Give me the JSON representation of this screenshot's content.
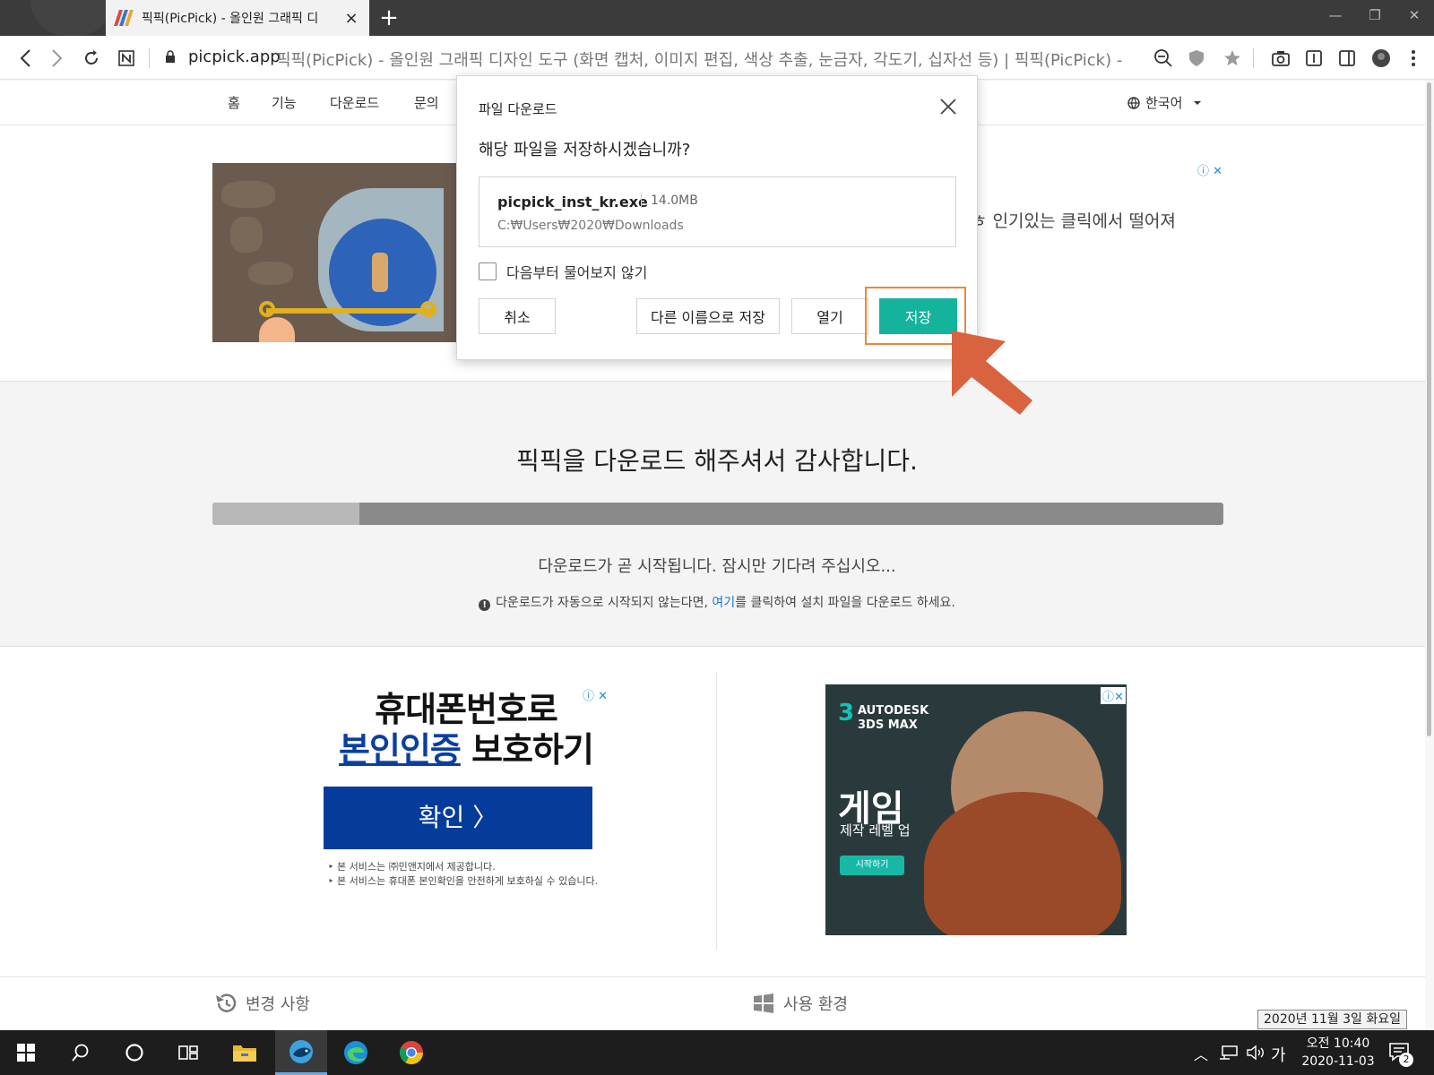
{
  "browser": {
    "tab_title": "픽픽(PicPick) - 올인원 그래픽 디",
    "address_host": "picpick.app",
    "address_title": "픽픽(PicPick) - 올인원 그래픽 디자인 도구 (화면 캡처, 이미지 편집, 색상 추출, 눈금자, 각도기, 십자선 등) | 픽픽(PicPick) -",
    "new_tab_label": "+",
    "tab_close": "×"
  },
  "site_nav": {
    "items": [
      "홈",
      "기능",
      "다운로드",
      "문의"
    ],
    "language": "한국어"
  },
  "top_ad": {
    "snippet": "ㅎ 인기있는 클릭에서 떨어져"
  },
  "download": {
    "thanks": "픽픽을 다운로드 해주셔서 감사합니다.",
    "progress": 0.145,
    "wait_message": "다운로드가 곧 시작됩니다. 잠시만 기다려 주십시오...",
    "note_before": "다운로드가 자동으로 시작되지 않는다면, ",
    "note_link": "여기",
    "note_after": "를 클릭하여 설치 파일을 다운로드 하세요."
  },
  "ad_left": {
    "line1": "휴대폰번호로",
    "line2_em": "본인인증",
    "line2_rest": " 보호하기",
    "button": "확인 〉",
    "fine1": "‣ 본 서비스는 ㈜민앤지에서 제공합니다.",
    "fine2": "‣ 본 서비스는 휴대폰 본인확인을 안전하게 보호하실 수 있습니다."
  },
  "ad_right": {
    "brand_num": "3",
    "brand_line1": "AUTODESK",
    "brand_line2": "3DS MAX",
    "headline": "게임",
    "sub": "제작 레벨 업",
    "cta": "시작하기"
  },
  "lower": {
    "changes": "변경 사항",
    "environment": "사용 환경"
  },
  "dialog": {
    "title": "파일 다운로드",
    "question": "해당 파일을 저장하시겠습니까?",
    "file_name": "picpick_inst_kr.exe",
    "file_size": "14.0MB",
    "file_path": "C:₩Users₩2020₩Downloads",
    "dont_ask": "다음부터 물어보지 않기",
    "cancel": "취소",
    "save_as": "다른 이름으로 저장",
    "open": "열기",
    "save": "저장"
  },
  "taskbar": {
    "ime": "가",
    "time": "오전 10:40",
    "date": "2020-11-03",
    "tooltip": "2020년 11월 3일 화요일",
    "notifications": "2"
  },
  "colors": {
    "save_button": "#14b39c",
    "highlight": "#e58a3c",
    "arrow": "#d9633f",
    "ad_button": "#053c9c"
  }
}
